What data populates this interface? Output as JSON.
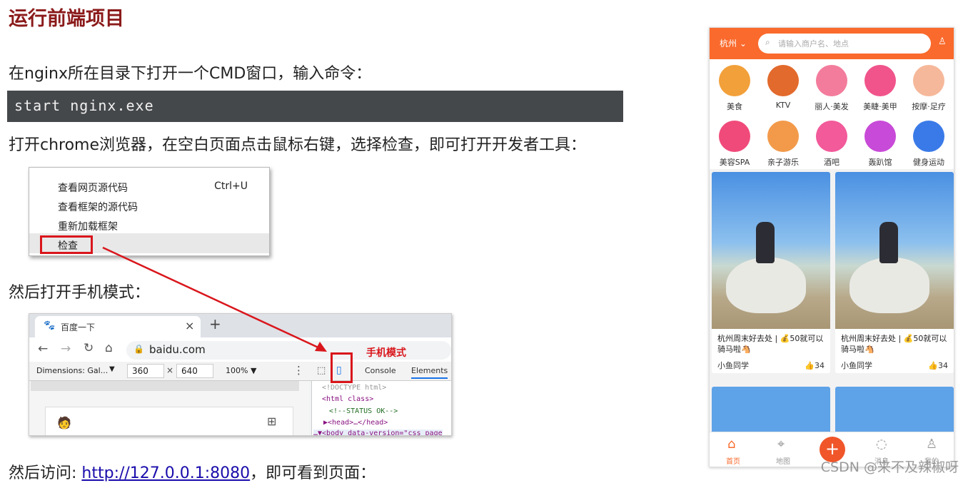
{
  "title": "运行前端项目",
  "p1": "在nginx所在目录下打开一个CMD窗口，输入命令：",
  "command": "start nginx.exe",
  "p2": "打开chrome浏览器，在空白页面点击鼠标右键，选择检查，即可打开开发者工具：",
  "context_menu": {
    "items": [
      "查看网页源代码",
      "查看框架的源代码",
      "重新加载框架",
      "检查"
    ],
    "shortcut": "Ctrl+U"
  },
  "p3": "然后打开手机模式：",
  "browser": {
    "tab_title": "百度一下",
    "new_tab": "+",
    "close": "×",
    "url": "baidu.com",
    "dimensions": "Dimensions: Gal...",
    "width": "360",
    "times": "×",
    "height": "640",
    "zoom": "100% ▼",
    "tab_console": "Console",
    "tab_elements": "Elements",
    "code_lines": [
      "<!DOCTYPE html>",
      "<html class>",
      "<!--STATUS OK-->",
      "▶<head>…</head>",
      "…▼<body data-version=\"css_page"
    ],
    "mobile_label": "手机模式"
  },
  "p4_prefix": "然后访问: ",
  "p4_link": "http://127.0.0.1:8080",
  "p4_suffix": "，即可看到页面：",
  "phone": {
    "city": "杭州 ⌄",
    "search_placeholder": "请输入商户名、地点",
    "categories": [
      "美食",
      "KTV",
      "丽人·美发",
      "美睫·美甲",
      "按摩·足疗",
      "美容SPA",
      "亲子游乐",
      "酒吧",
      "轰趴馆",
      "健身运动"
    ],
    "card_text_1": "杭州周末好去处 | 💰50就可以骑马啦🐴",
    "card_text_2": "杭州周末好去处 | 💰50就可以骑马啦🐴",
    "card_user_1": "小鱼同学",
    "card_user_2": "小鱼同学",
    "card_likes_1": "34",
    "card_likes_2": "34",
    "nav": [
      "首页",
      "地图",
      "",
      "消息",
      "我的"
    ]
  },
  "watermark": "CSDN @来不及辣椒呀",
  "colors": {
    "accent": "#fa6a2c",
    "title": "#8b1a1a",
    "highlight": "#d9161c"
  }
}
